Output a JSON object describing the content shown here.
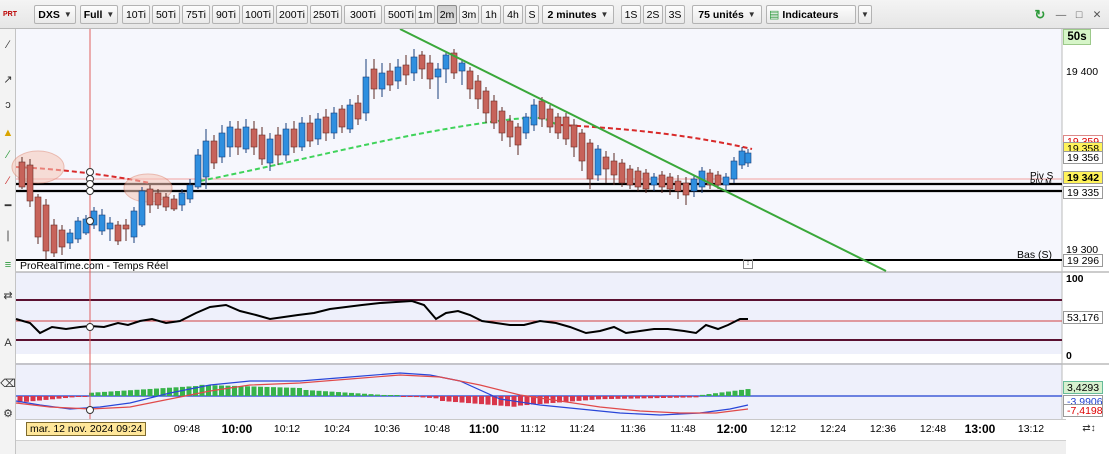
{
  "toolbar": {
    "symbol": "DXS",
    "mode": "Full",
    "tick_buttons": [
      "10Ti",
      "50Ti",
      "75Ti",
      "90Ti",
      "100Ti",
      "200Ti",
      "250Ti",
      "300Ti",
      "500Ti"
    ],
    "minute_buttons": [
      "1m",
      "2m",
      "3m",
      "1h",
      "4h",
      "S"
    ],
    "selected_minute": "2m",
    "period": "2 minutes",
    "second_buttons": [
      "1S",
      "2S",
      "3S"
    ],
    "units": "75 unités",
    "indicators": "Indicateurs",
    "countdown": "50s"
  },
  "chart": {
    "source_label": "ProRealTime.com - Temps Réel",
    "labels": {
      "piv": "Piv S",
      "pivm": "PIV M",
      "bas": "Bas (S)"
    },
    "price_axis": {
      "ticks": [
        "19 400",
        "19 300"
      ],
      "tags": [
        "19 359",
        "19 358",
        "19 356",
        "19 342",
        "19 335",
        "19 296"
      ]
    },
    "osc_axis": {
      "ticks": [
        "100",
        "0"
      ],
      "value": "53,176"
    },
    "macd_axis": {
      "values": [
        "3,4293",
        "-3,9906",
        "-7,4198"
      ]
    }
  },
  "time_axis": {
    "labels": [
      "09:48",
      "10:00",
      "10:12",
      "10:24",
      "10:36",
      "10:48",
      "11:00",
      "11:12",
      "11:24",
      "11:36",
      "11:48",
      "12:00",
      "12:12",
      "12:24",
      "12:36",
      "12:48",
      "13:00",
      "13:12"
    ],
    "bold": [
      "10:00",
      "11:00",
      "12:00",
      "13:00"
    ],
    "cursor_date": "mar. 12 nov. 2024 09:24"
  },
  "colors": {
    "bull": "#2f8fdf",
    "bear": "#c7635a",
    "trendline": "#3aa83a",
    "ma_green": "#3fd35a",
    "ma_red": "#d82a2a",
    "histo_pos": "#37b34a",
    "histo_neg": "#d9364a"
  }
}
